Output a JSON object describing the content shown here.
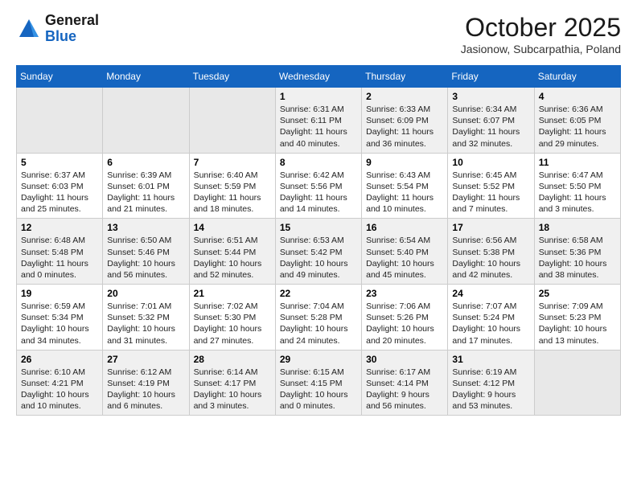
{
  "header": {
    "logo_general": "General",
    "logo_blue": "Blue",
    "month_title": "October 2025",
    "location": "Jasionow, Subcarpathia, Poland"
  },
  "days_of_week": [
    "Sunday",
    "Monday",
    "Tuesday",
    "Wednesday",
    "Thursday",
    "Friday",
    "Saturday"
  ],
  "weeks": [
    [
      {
        "day": "",
        "info": ""
      },
      {
        "day": "",
        "info": ""
      },
      {
        "day": "",
        "info": ""
      },
      {
        "day": "1",
        "info": "Sunrise: 6:31 AM\nSunset: 6:11 PM\nDaylight: 11 hours\nand 40 minutes."
      },
      {
        "day": "2",
        "info": "Sunrise: 6:33 AM\nSunset: 6:09 PM\nDaylight: 11 hours\nand 36 minutes."
      },
      {
        "day": "3",
        "info": "Sunrise: 6:34 AM\nSunset: 6:07 PM\nDaylight: 11 hours\nand 32 minutes."
      },
      {
        "day": "4",
        "info": "Sunrise: 6:36 AM\nSunset: 6:05 PM\nDaylight: 11 hours\nand 29 minutes."
      }
    ],
    [
      {
        "day": "5",
        "info": "Sunrise: 6:37 AM\nSunset: 6:03 PM\nDaylight: 11 hours\nand 25 minutes."
      },
      {
        "day": "6",
        "info": "Sunrise: 6:39 AM\nSunset: 6:01 PM\nDaylight: 11 hours\nand 21 minutes."
      },
      {
        "day": "7",
        "info": "Sunrise: 6:40 AM\nSunset: 5:59 PM\nDaylight: 11 hours\nand 18 minutes."
      },
      {
        "day": "8",
        "info": "Sunrise: 6:42 AM\nSunset: 5:56 PM\nDaylight: 11 hours\nand 14 minutes."
      },
      {
        "day": "9",
        "info": "Sunrise: 6:43 AM\nSunset: 5:54 PM\nDaylight: 11 hours\nand 10 minutes."
      },
      {
        "day": "10",
        "info": "Sunrise: 6:45 AM\nSunset: 5:52 PM\nDaylight: 11 hours\nand 7 minutes."
      },
      {
        "day": "11",
        "info": "Sunrise: 6:47 AM\nSunset: 5:50 PM\nDaylight: 11 hours\nand 3 minutes."
      }
    ],
    [
      {
        "day": "12",
        "info": "Sunrise: 6:48 AM\nSunset: 5:48 PM\nDaylight: 11 hours\nand 0 minutes."
      },
      {
        "day": "13",
        "info": "Sunrise: 6:50 AM\nSunset: 5:46 PM\nDaylight: 10 hours\nand 56 minutes."
      },
      {
        "day": "14",
        "info": "Sunrise: 6:51 AM\nSunset: 5:44 PM\nDaylight: 10 hours\nand 52 minutes."
      },
      {
        "day": "15",
        "info": "Sunrise: 6:53 AM\nSunset: 5:42 PM\nDaylight: 10 hours\nand 49 minutes."
      },
      {
        "day": "16",
        "info": "Sunrise: 6:54 AM\nSunset: 5:40 PM\nDaylight: 10 hours\nand 45 minutes."
      },
      {
        "day": "17",
        "info": "Sunrise: 6:56 AM\nSunset: 5:38 PM\nDaylight: 10 hours\nand 42 minutes."
      },
      {
        "day": "18",
        "info": "Sunrise: 6:58 AM\nSunset: 5:36 PM\nDaylight: 10 hours\nand 38 minutes."
      }
    ],
    [
      {
        "day": "19",
        "info": "Sunrise: 6:59 AM\nSunset: 5:34 PM\nDaylight: 10 hours\nand 34 minutes."
      },
      {
        "day": "20",
        "info": "Sunrise: 7:01 AM\nSunset: 5:32 PM\nDaylight: 10 hours\nand 31 minutes."
      },
      {
        "day": "21",
        "info": "Sunrise: 7:02 AM\nSunset: 5:30 PM\nDaylight: 10 hours\nand 27 minutes."
      },
      {
        "day": "22",
        "info": "Sunrise: 7:04 AM\nSunset: 5:28 PM\nDaylight: 10 hours\nand 24 minutes."
      },
      {
        "day": "23",
        "info": "Sunrise: 7:06 AM\nSunset: 5:26 PM\nDaylight: 10 hours\nand 20 minutes."
      },
      {
        "day": "24",
        "info": "Sunrise: 7:07 AM\nSunset: 5:24 PM\nDaylight: 10 hours\nand 17 minutes."
      },
      {
        "day": "25",
        "info": "Sunrise: 7:09 AM\nSunset: 5:23 PM\nDaylight: 10 hours\nand 13 minutes."
      }
    ],
    [
      {
        "day": "26",
        "info": "Sunrise: 6:10 AM\nSunset: 4:21 PM\nDaylight: 10 hours\nand 10 minutes."
      },
      {
        "day": "27",
        "info": "Sunrise: 6:12 AM\nSunset: 4:19 PM\nDaylight: 10 hours\nand 6 minutes."
      },
      {
        "day": "28",
        "info": "Sunrise: 6:14 AM\nSunset: 4:17 PM\nDaylight: 10 hours\nand 3 minutes."
      },
      {
        "day": "29",
        "info": "Sunrise: 6:15 AM\nSunset: 4:15 PM\nDaylight: 10 hours\nand 0 minutes."
      },
      {
        "day": "30",
        "info": "Sunrise: 6:17 AM\nSunset: 4:14 PM\nDaylight: 9 hours\nand 56 minutes."
      },
      {
        "day": "31",
        "info": "Sunrise: 6:19 AM\nSunset: 4:12 PM\nDaylight: 9 hours\nand 53 minutes."
      },
      {
        "day": "",
        "info": ""
      }
    ]
  ]
}
